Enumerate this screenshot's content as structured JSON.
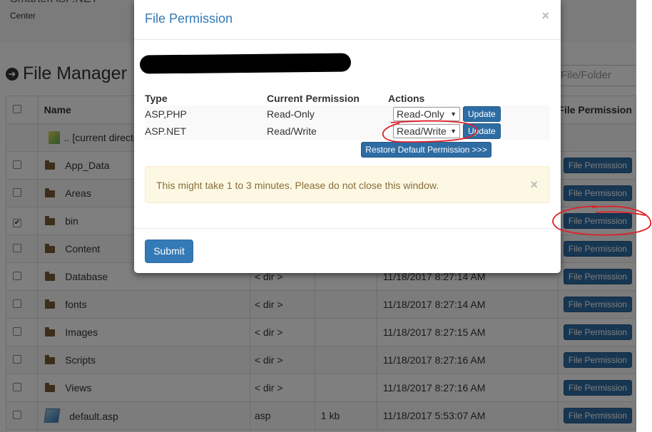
{
  "header": {
    "title": "SmarterASP.NET",
    "subtitle": "Center"
  },
  "file_manager": {
    "title": "File Manager",
    "search_placeholder": "File/Folder"
  },
  "grid": {
    "columns": {
      "name": "Name",
      "file_permission": "File Permission"
    },
    "current_dir_label": ".. [current directo",
    "rows": [
      {
        "name": "App_Data",
        "type": "",
        "size": "",
        "date": "",
        "checked": false,
        "button": "File Permission"
      },
      {
        "name": "Areas",
        "type": "",
        "size": "",
        "date": "",
        "checked": false,
        "button": "File Permission"
      },
      {
        "name": "bin",
        "type": "",
        "size": "",
        "date": "",
        "checked": true,
        "button": "File Permission"
      },
      {
        "name": "Content",
        "type": "",
        "size": "",
        "date": "",
        "checked": false,
        "button": "File Permission"
      },
      {
        "name": "Database",
        "type": "< dir >",
        "size": "",
        "date": "11/18/2017 8:27:14 AM",
        "checked": false,
        "button": "File Permission"
      },
      {
        "name": "fonts",
        "type": "< dir >",
        "size": "",
        "date": "11/18/2017 8:27:14 AM",
        "checked": false,
        "button": "File Permission"
      },
      {
        "name": "Images",
        "type": "< dir >",
        "size": "",
        "date": "11/18/2017 8:27:15 AM",
        "checked": false,
        "button": "File Permission"
      },
      {
        "name": "Scripts",
        "type": "< dir >",
        "size": "",
        "date": "11/18/2017 8:27:16 AM",
        "checked": false,
        "button": "File Permission"
      },
      {
        "name": "Views",
        "type": "< dir >",
        "size": "",
        "date": "11/18/2017 8:27:16 AM",
        "checked": false,
        "button": "File Permission"
      },
      {
        "name": "default.asp",
        "type": "asp",
        "size": "1 kb",
        "date": "11/18/2017 5:53:07 AM",
        "checked": false,
        "button": "File Permission"
      }
    ]
  },
  "modal": {
    "title": "File Permission",
    "close_glyph": "×",
    "columns": {
      "type": "Type",
      "current": "Current Permission",
      "actions": "Actions"
    },
    "rows": [
      {
        "type": "ASP,PHP",
        "current": "Read-Only",
        "select_value": "Read-Only",
        "update_label": "Update"
      },
      {
        "type": "ASP.NET",
        "current": "Read/Write",
        "select_value": "Read/Write",
        "update_label": "Update"
      }
    ],
    "restore_label": "Restore Default Permission >>>",
    "alert_text": "This might take 1 to 3 minutes. Please do not close this window.",
    "alert_close_glyph": "×",
    "submit_label": "Submit"
  },
  "colors": {
    "primary": "#337ab7",
    "annotation": "#e0202a",
    "alert_bg": "#fcf8e3",
    "alert_text": "#8a6d3b"
  }
}
